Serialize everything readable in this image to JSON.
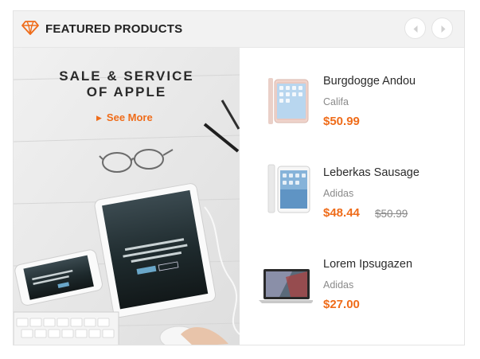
{
  "header": {
    "title": "FEATURED PRODUCTS",
    "icon": "diamond-icon",
    "accent": "#ef6c1a"
  },
  "banner": {
    "line1": "SALE & SERVICE",
    "line2": "OF APPLE",
    "link": "See More",
    "screen_text": "Dominate Your Market with the Rainmaker Platform"
  },
  "products": [
    {
      "name": "Burgdogge Andou",
      "brand": "Califa",
      "price": "$50.99",
      "old_price": "",
      "thumb": "iphone"
    },
    {
      "name": "Leberkas Sausage",
      "brand": "Adidas",
      "price": "$48.44",
      "old_price": "$50.99",
      "thumb": "ipad"
    },
    {
      "name": "Lorem Ipsugazen",
      "brand": "Adidas",
      "price": "$27.00",
      "old_price": "",
      "thumb": "macbook"
    }
  ]
}
